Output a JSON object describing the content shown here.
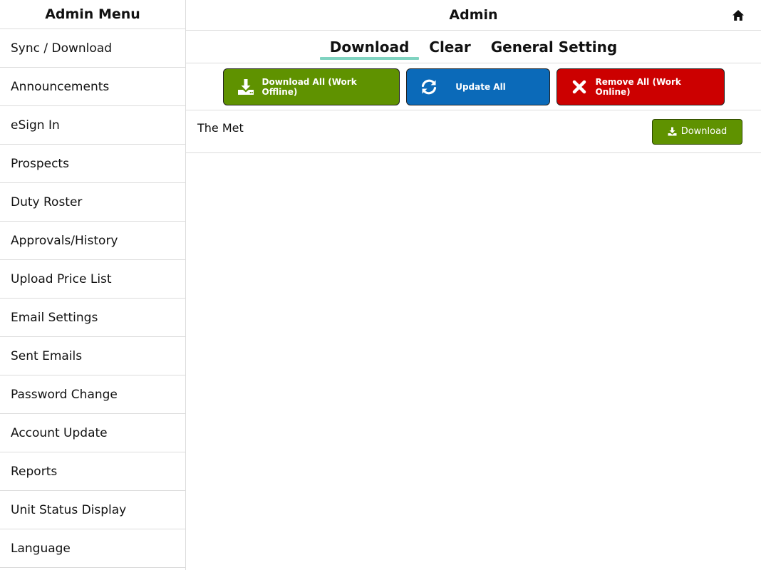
{
  "sidebar": {
    "title": "Admin Menu",
    "items": [
      {
        "label": "Sync / Download"
      },
      {
        "label": "Announcements"
      },
      {
        "label": "eSign In"
      },
      {
        "label": "Prospects"
      },
      {
        "label": "Duty Roster"
      },
      {
        "label": "Approvals/History"
      },
      {
        "label": "Upload Price List"
      },
      {
        "label": "Email Settings"
      },
      {
        "label": "Sent Emails"
      },
      {
        "label": "Password Change"
      },
      {
        "label": "Account Update"
      },
      {
        "label": "Reports"
      },
      {
        "label": "Unit Status Display"
      },
      {
        "label": "Language"
      }
    ]
  },
  "header": {
    "title": "Admin",
    "home_icon": "home-icon"
  },
  "tabs": [
    {
      "label": "Download",
      "active": true
    },
    {
      "label": "Clear",
      "active": false
    },
    {
      "label": "General Setting",
      "active": false
    }
  ],
  "actions": {
    "download_all": {
      "label": "Download All (Work Offline)",
      "color": "#5f9200",
      "icon": "download-icon"
    },
    "update_all": {
      "label": "Update All",
      "color": "#0b6ab9",
      "icon": "refresh-icon"
    },
    "remove_all": {
      "label": "Remove All (Work Online)",
      "color": "#cc0000",
      "icon": "close-icon"
    }
  },
  "rows": [
    {
      "name": "The Met",
      "button_label": "Download"
    }
  ],
  "colors": {
    "tab_underline": "#7fd3c0",
    "border": "#dcdcdc"
  }
}
